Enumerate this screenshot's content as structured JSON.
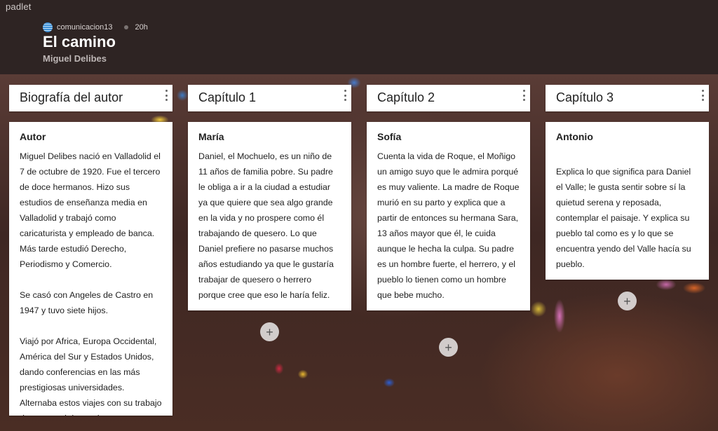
{
  "app": {
    "brand": "padlet"
  },
  "header": {
    "author": "comunicacion13",
    "time": "20h",
    "title": "El camino",
    "subtitle": "Miguel Delibes"
  },
  "columns": [
    {
      "title": "Biografía del autor",
      "card": {
        "heading": "Autor",
        "body": "Miguel Delibes nació en Valladolid el 7 de octubre de 1920. Fue el tercero de doce hermanos. Hizo sus estudios de enseñanza media en Valladolid y trabajó como caricaturista y empleado de banca. Más tarde estudió Derecho, Periodismo y Comercio.\n\nSe casó con Angeles de Castro en 1947 y tuvo siete hijos.\n\nViajó por Africa, Europa Occidental, América del Sur y Estados Unidos, dando conferencias en las más prestigiosas universidades. Alternaba estos viajes con su trabajo docente y el de escritor."
      }
    },
    {
      "title": "Capítulo 1",
      "card": {
        "heading": "María",
        "body": "Daniel, el Mochuelo, es un niño de 11 años de familia pobre. Su padre le obliga a ir a la ciudad a estudiar ya que quiere que sea algo grande en la vida y no prospere como él trabajando de quesero. Lo que Daniel prefiere no pasarse muchos años estudiando ya que le gustaría trabajar de quesero o herrero porque cree que eso le haría feliz."
      }
    },
    {
      "title": "Capítulo 2",
      "card": {
        "heading": "Sofía",
        "body": "Cuenta la vida de Roque, el Moñigo un amigo suyo que le admira porqué es muy valiente. La madre de Roque murió en su parto y explica que a partir de entonces su hermana Sara, 13 años mayor que él, le cuida aunque le hecha la culpa. Su padre es un hombre fuerte, el herrero, y el pueblo lo tienen como un hombre que bebe mucho."
      }
    },
    {
      "title": "Capítulo 3",
      "card": {
        "heading": "Antonio",
        "body": "\nExplica lo que significa para Daniel el Valle; le gusta sentir sobre sí la quietud serena y reposada, contemplar el paisaje. Y explica su pueblo tal como es y lo que se encuentra yendo del Valle hacía su pueblo."
      }
    }
  ],
  "icons": {
    "add": "+",
    "more": "kebab-vertical",
    "author_avatar": "globe"
  }
}
